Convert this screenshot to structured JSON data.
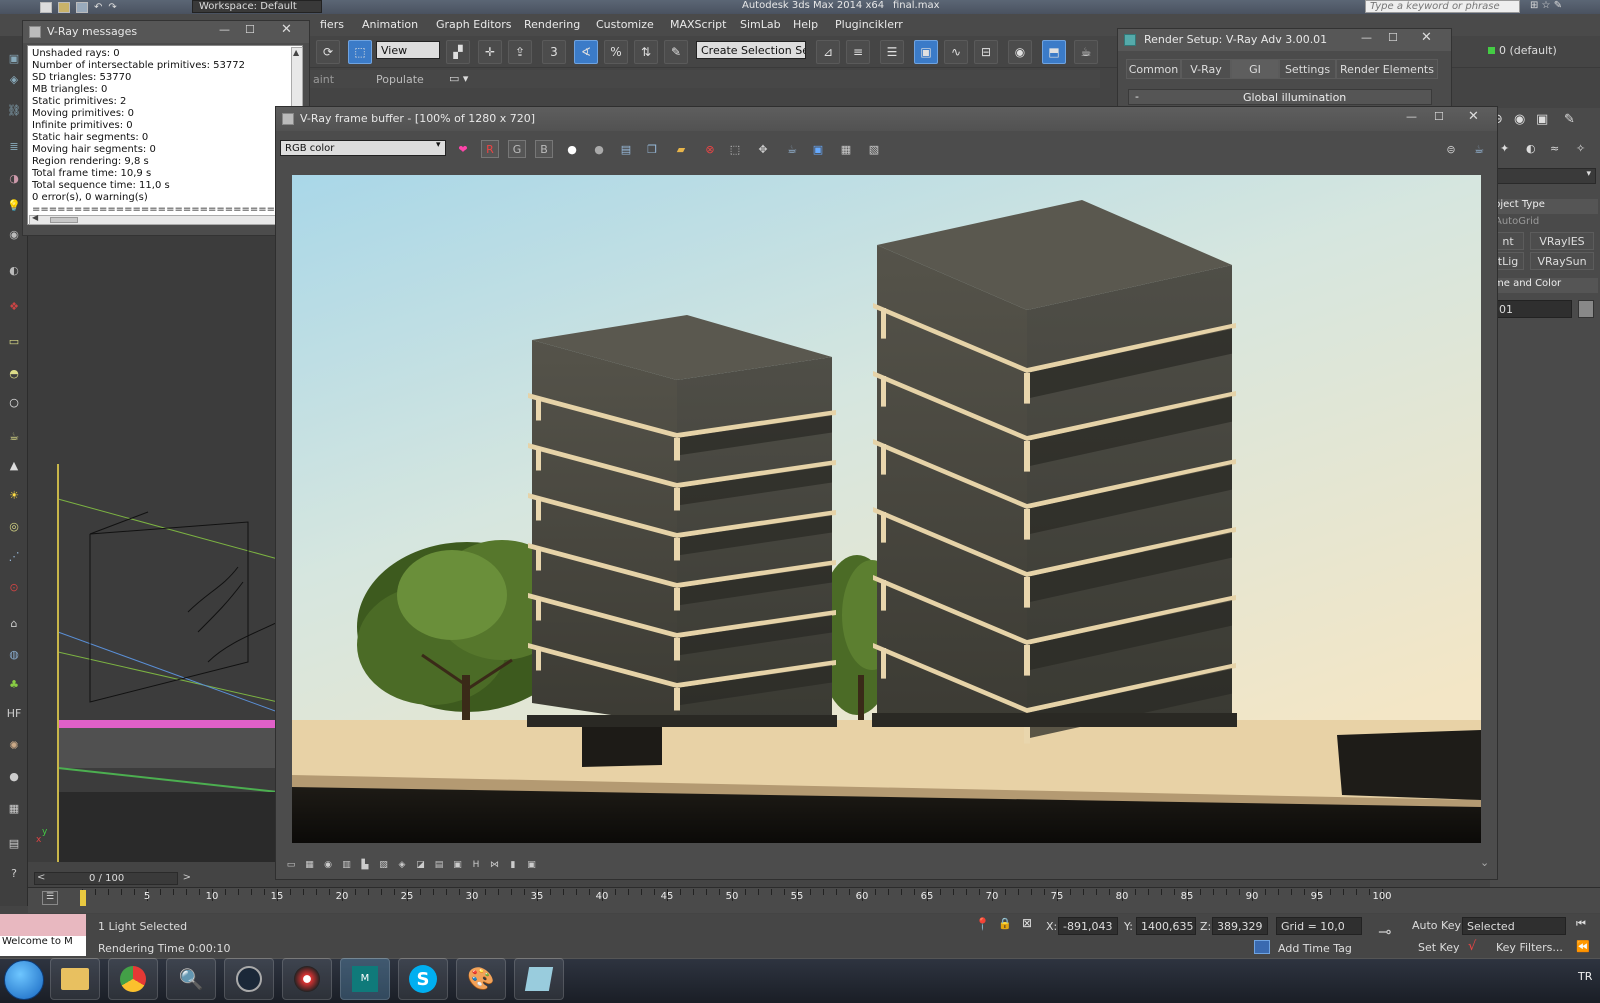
{
  "app": {
    "title": "Autodesk 3ds Max  2014 x64",
    "file": "final.max",
    "workspace": "Workspace: Default",
    "search_placeholder": "Type a keyword or phrase"
  },
  "menu": [
    "fiers",
    "Animation",
    "Graph Editors",
    "Rendering",
    "Customize",
    "MAXScript",
    "SimLab",
    "Help",
    "Pluginciklerr"
  ],
  "toolbar": {
    "view_select": "View",
    "selection_set": "Create Selection Se",
    "layer": "0 (default)",
    "ribbon_items": [
      "aint",
      "Populate"
    ]
  },
  "vray_messages": {
    "title": "V-Ray messages",
    "lines": [
      "  Unshaded rays: 0",
      "Number of intersectable primitives: 53772",
      "  SD triangles: 53770",
      "  MB triangles: 0",
      "  Static primitives: 2",
      "  Moving primitives: 0",
      "  Infinite primitives: 0",
      "  Static hair segments: 0",
      "  Moving hair segments: 0",
      "Region rendering: 9,8 s",
      "Total frame time: 10,9 s",
      "Total sequence time: 11,0 s",
      "0 error(s), 0 warning(s)",
      "================================"
    ]
  },
  "render_setup": {
    "title": "Render Setup: V-Ray Adv 3.00.01",
    "tabs": [
      "Common",
      "V-Ray",
      "GI",
      "Settings",
      "Render Elements"
    ],
    "rollout": "Global illumination"
  },
  "vfb": {
    "title": "V-Ray frame buffer - [100% of 1280 x 720]",
    "channel": "RGB color",
    "r": "R",
    "g": "G",
    "b": "B"
  },
  "command_panel": {
    "rollout_object_type": "bject Type",
    "autogrid": "AutoGrid",
    "buttons": [
      "nt",
      "VRayIES",
      "tLig",
      "VRaySun"
    ],
    "rollout_name_color": "me and Color",
    "name_value": "01"
  },
  "viewport": {
    "frame_counter": "0 / 100"
  },
  "timeline": {
    "ticks": [
      "5",
      "10",
      "15",
      "20",
      "25",
      "30",
      "35",
      "40",
      "45",
      "50",
      "55",
      "60",
      "65",
      "70",
      "75",
      "80",
      "85",
      "90",
      "95",
      "100"
    ]
  },
  "status": {
    "welcome": "Welcome to M",
    "selection": "1 Light Selected",
    "rendering_time": "Rendering Time  0:00:10",
    "x_label": "X:",
    "x_value": "-891,043",
    "y_label": "Y:",
    "y_value": "1400,635",
    "z_label": "Z:",
    "z_value": "389,329",
    "grid": "Grid = 10,0",
    "add_time_tag": "Add Time Tag",
    "auto_key": "Auto Key",
    "set_key": "Set Key",
    "key_mode": "Selected",
    "key_filters": "Key Filters..."
  },
  "taskbar": {
    "language": "TR"
  }
}
